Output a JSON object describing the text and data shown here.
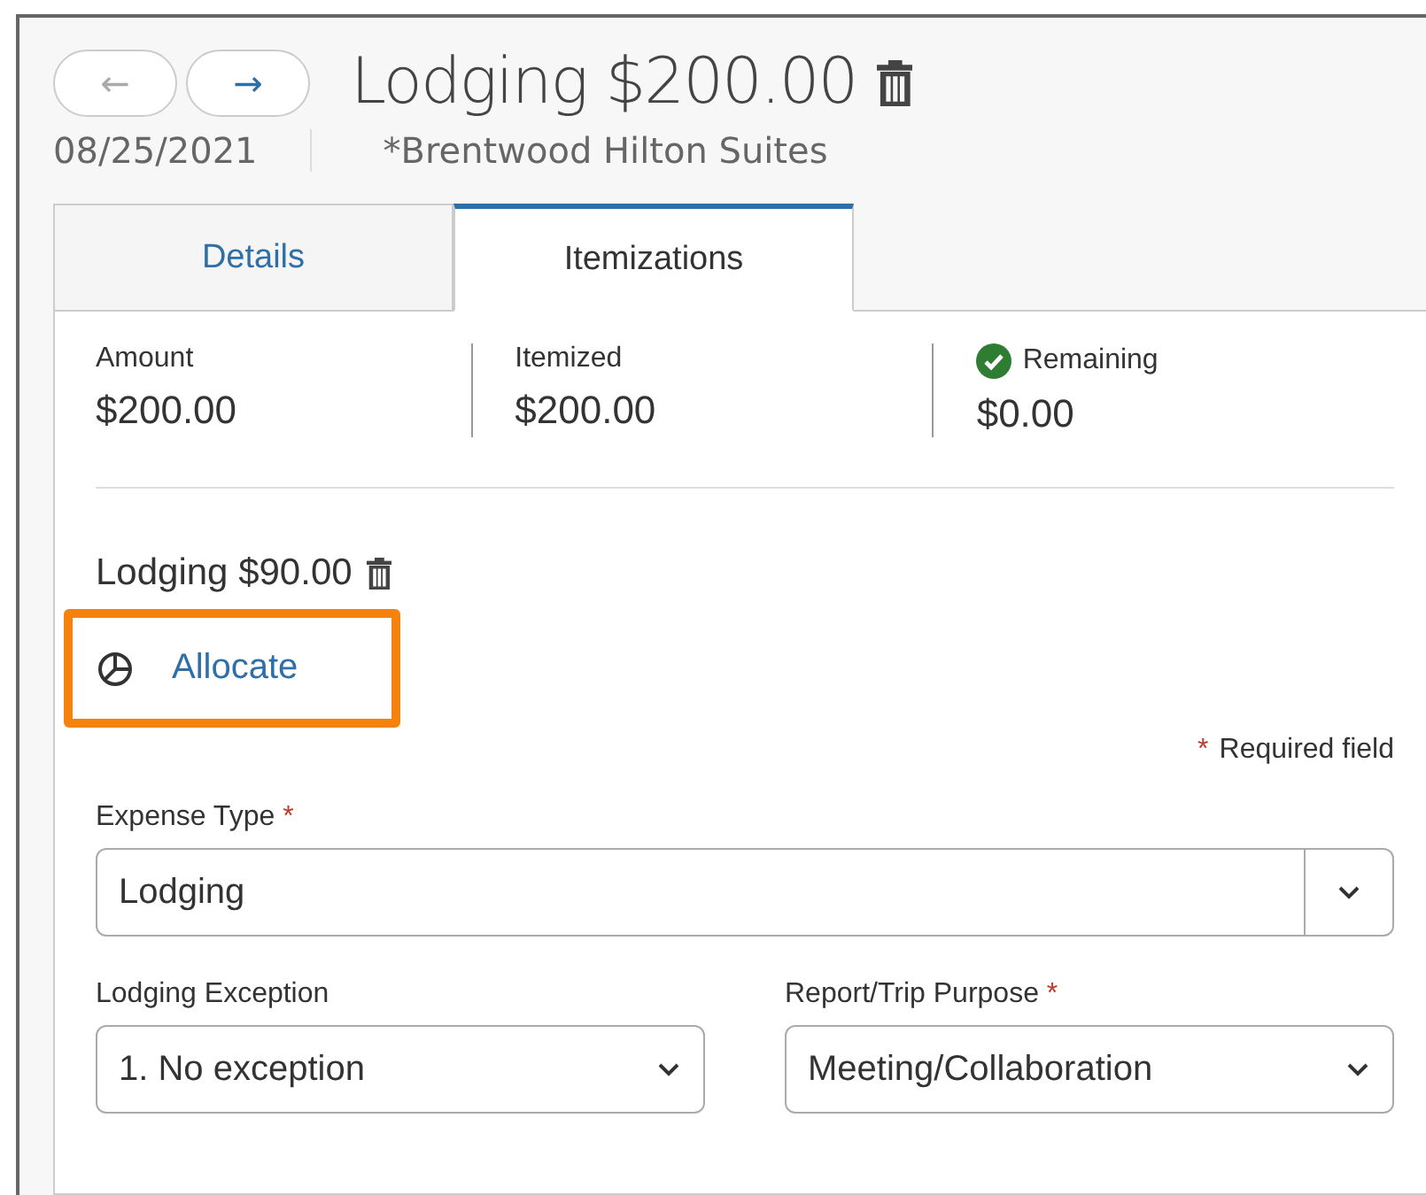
{
  "nav_buttons": [
    {
      "label": "←",
      "disabled": true
    },
    {
      "label": "→",
      "disabled": false
    }
  ],
  "title": "Lodging $200.00",
  "date": "08/25/2021",
  "vendor": "*Brentwood Hilton Suites",
  "tabs": [
    {
      "label": "Details",
      "selected": false
    },
    {
      "label": "Itemizations",
      "selected": true
    }
  ],
  "summary": [
    {
      "label": "Amount",
      "value": "$200.00",
      "checked": false
    },
    {
      "label": "Itemized",
      "value": "$200.00",
      "checked": false
    },
    {
      "label": "Remaining",
      "value": "$0.00",
      "checked": true
    }
  ],
  "itemization": {
    "title": "Lodging $90.00",
    "allocate": "Allocate",
    "highlighted": true
  },
  "required_note": {
    "mark": "*",
    "text": "Required field"
  },
  "field_rows": [
    [
      {
        "label": "Expense Type",
        "required_mark": "*",
        "value": "Lodging",
        "kind": "split"
      }
    ],
    [
      {
        "label": "Lodging Exception",
        "value": "1. No exception",
        "kind": "plain"
      },
      {
        "label": "Report/Trip Purpose",
        "required_mark": "*",
        "value": "Meeting/Collaboration",
        "kind": "plain"
      }
    ]
  ]
}
